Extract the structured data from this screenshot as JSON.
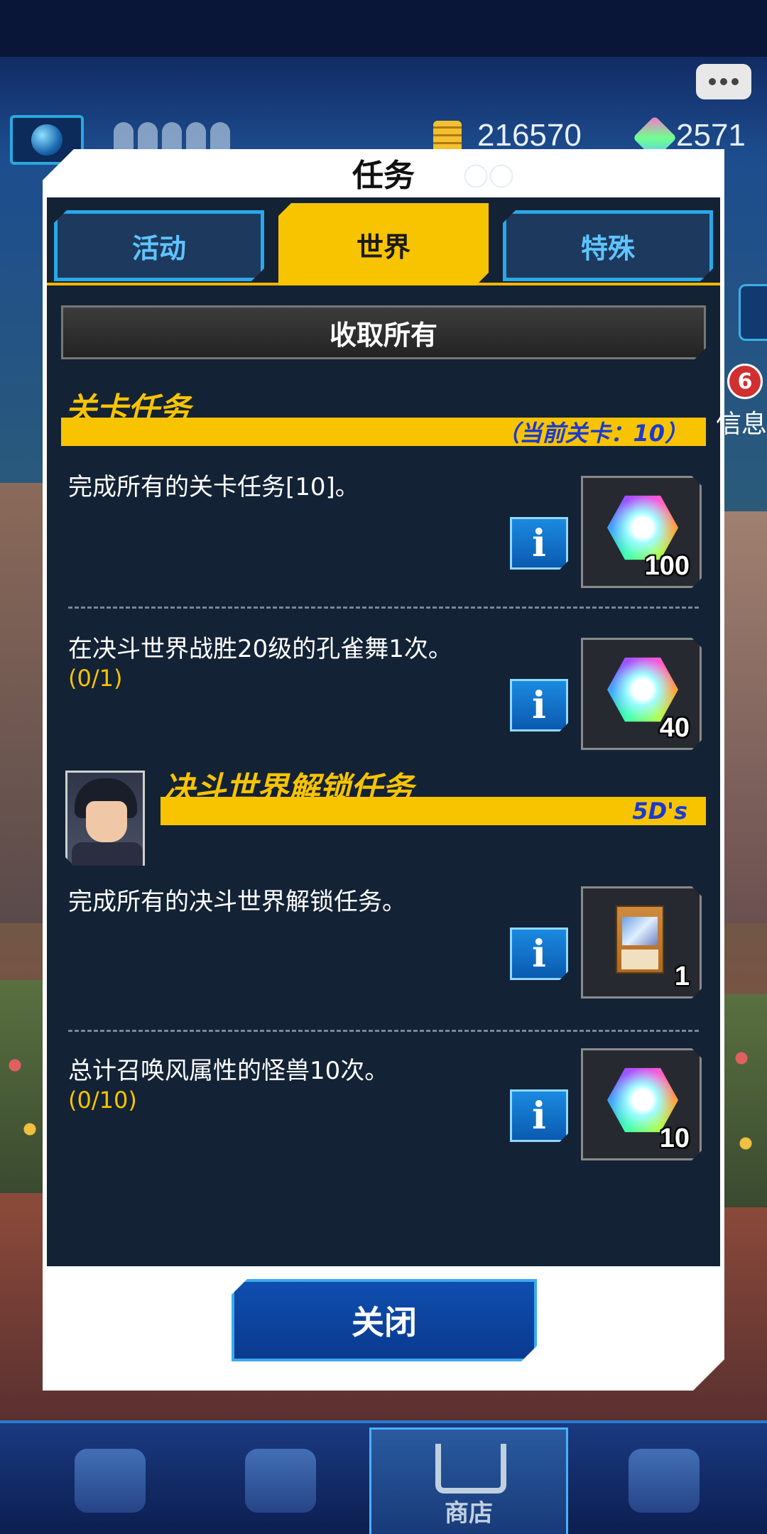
{
  "hud": {
    "gold": "216570",
    "gems": "2571"
  },
  "dialog": {
    "title": "任务",
    "tabs": [
      {
        "label": "活动",
        "active": false
      },
      {
        "label": "世界",
        "active": true
      },
      {
        "label": "特殊",
        "active": false
      }
    ],
    "collect_all_label": "收取所有",
    "close_label": "关闭"
  },
  "sections": [
    {
      "title": "关卡任务",
      "subtitle": "（当前关卡：10）",
      "tasks": [
        {
          "text": "完成所有的关卡任务[10]。",
          "progress": "",
          "reward_type": "gem",
          "reward_count": "100"
        },
        {
          "text": "在决斗世界战胜20级的孔雀舞1次。",
          "progress": "(0/1)",
          "reward_type": "gem",
          "reward_count": "40"
        }
      ]
    },
    {
      "title": "决斗世界解锁任务",
      "subtitle": "5D's",
      "tasks": [
        {
          "text": "完成所有的决斗世界解锁任务。",
          "progress": "",
          "reward_type": "card",
          "reward_count": "1"
        },
        {
          "text": "总计召唤风属性的怪兽10次。",
          "progress": "(0/10)",
          "reward_type": "gem",
          "reward_count": "10"
        }
      ]
    }
  ],
  "side": {
    "badge": "6",
    "label": "信息"
  },
  "bottom_nav": {
    "shop_label": "商店"
  },
  "colors": {
    "accent_yellow": "#f8c400",
    "panel_bg": "#132235",
    "tab_blue": "#2aa8e8",
    "subtitle_blue": "#1a3ad0"
  },
  "icons": [
    "globe-icon",
    "gold-icon",
    "gem-icon",
    "chat-icon",
    "info-icon",
    "card-icon",
    "shop-cart-icon"
  ]
}
